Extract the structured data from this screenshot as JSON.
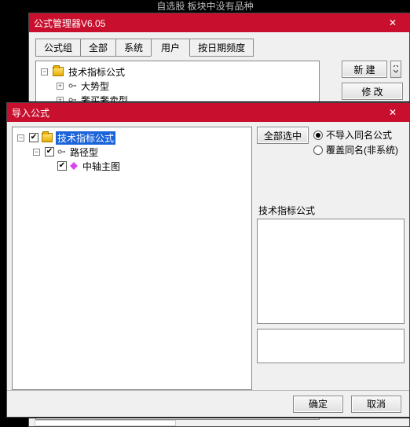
{
  "topstrip": "自选股 板块中没有品种",
  "main": {
    "title": "公式管理器V6.05",
    "tabs": [
      "公式组",
      "全部",
      "系统",
      "用户",
      "按日期频度"
    ],
    "active_tab_index": 3,
    "buttons": {
      "new": "新  建",
      "edit": "修  改"
    },
    "tree": {
      "root": "技术指标公式",
      "c1": "大势型",
      "c2_partial": "奢买奢卖型"
    }
  },
  "import": {
    "title": "导入公式",
    "select_all": "全部选中",
    "radios": {
      "skip": "不导入同名公式",
      "overwrite": "覆盖同名(非系统)"
    },
    "panel_label": "技术指标公式",
    "ok": "确定",
    "cancel": "取消",
    "tree": {
      "root": "技术指标公式",
      "c1": "路径型",
      "c2": "中轴主图"
    }
  },
  "icons": {
    "close": "✕",
    "check": "✔"
  }
}
